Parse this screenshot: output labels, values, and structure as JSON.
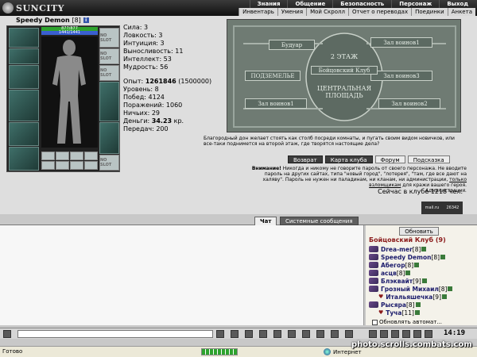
{
  "app": {
    "logo_text": "SUNCITY"
  },
  "menu_top": [
    "Знания",
    "Общение",
    "Безопасность",
    "Персонаж",
    "Выход"
  ],
  "menu_sub": [
    "Инвентарь",
    "Умения",
    "Мой Скролл",
    "Отчет о переводах",
    "Поединки",
    "Анкета"
  ],
  "character": {
    "name": "Speedy Demon",
    "level": "[8]",
    "hp": "877/877",
    "mp": "1441/1441",
    "slot_empty_label": "NO SLOT"
  },
  "stats": {
    "strength": "Сила: 3",
    "agility": "Ловкость: 3",
    "intuition": "Интуиция: 3",
    "endurance": "Выносливость: 11",
    "intellect": "Интеллект: 53",
    "wisdom": "Мудрость: 56",
    "experience_label": "Опыт: ",
    "experience_value": "1261846",
    "experience_next": " (1500000)",
    "level": "Уровень: 8",
    "wins": "Побед: 4124",
    "losses": "Поражений: 1060",
    "draws": "Ничьих: 29",
    "money_label": "Деньги: ",
    "money_value": "34.23",
    "money_unit": " кр.",
    "transfers": "Передач: 200"
  },
  "map": {
    "boudoir": "Будуар",
    "floor2": "2 ЭТАЖ",
    "club": "Бойцовский Клуб",
    "hall_novice": "Зал воинов1",
    "hall_2": "Зал воинов3",
    "basement": "ПОДЗЕМЕЛЬЕ",
    "central_square": "ЦЕНТРАЛЬНАЯ ПЛОЩАДЬ",
    "hall_left": "Зал воинов1",
    "hall_right": "Зал воинов2"
  },
  "description": "Благородный дон желает стоять как столб посреди комнаты, и пугать своим видом новичков, или все-таки поднимется на второй этаж, где творятся настоящие дела?",
  "buttons": {
    "back": "Возврат",
    "club_map": "Карта клуба",
    "forum": "Форум",
    "hint": "Подсказка",
    "refresh": "Обновить"
  },
  "warning": {
    "prefix": "Внимание!",
    "text": " Никогда и никому не говорите пароль от своего персонажа. Не вводите пароль на других сайтах, типа \"новый город\", \"лотерея\", \"там, где все дают на халяву\". Пароль не нужен ни паладинам, ни кланам, ни администрации, ",
    "link": "только взломщикам",
    "suffix": " для кражи вашего героя.",
    "signature": "Администрация."
  },
  "online": "Сейчас в клубе 1218 чел.",
  "counter": {
    "left": "mail.ru",
    "right": "26342"
  },
  "chat": {
    "tab_chat": "Чат",
    "tab_system": "Системные сообщения"
  },
  "club_title": "Бойцовский Клуб (9)",
  "users": [
    {
      "name": "Drea-mer",
      "level": "[8]",
      "indent": false
    },
    {
      "name": "Speedy Demon",
      "level": "[8]",
      "indent": false
    },
    {
      "name": "Абегор",
      "level": "[8]",
      "indent": false
    },
    {
      "name": "асцв",
      "level": "[8]",
      "indent": false
    },
    {
      "name": "Блэквайт",
      "level": "[9]",
      "indent": false
    },
    {
      "name": "Грозный Михаил",
      "level": "[8]",
      "indent": false
    },
    {
      "name": "Итальяшечка",
      "level": "[9]",
      "indent": true
    },
    {
      "name": "Рысяра",
      "level": "[8]",
      "indent": false
    },
    {
      "name": "Туча",
      "level": "[11]",
      "indent": true
    }
  ],
  "auto_refresh": "Обновлять автомат...",
  "clock": "14:19",
  "status": {
    "ready": "Готово",
    "zone": "Интернет",
    "progress_fraction": 1.0
  },
  "watermark": "photo.scrolls.combats.com"
}
